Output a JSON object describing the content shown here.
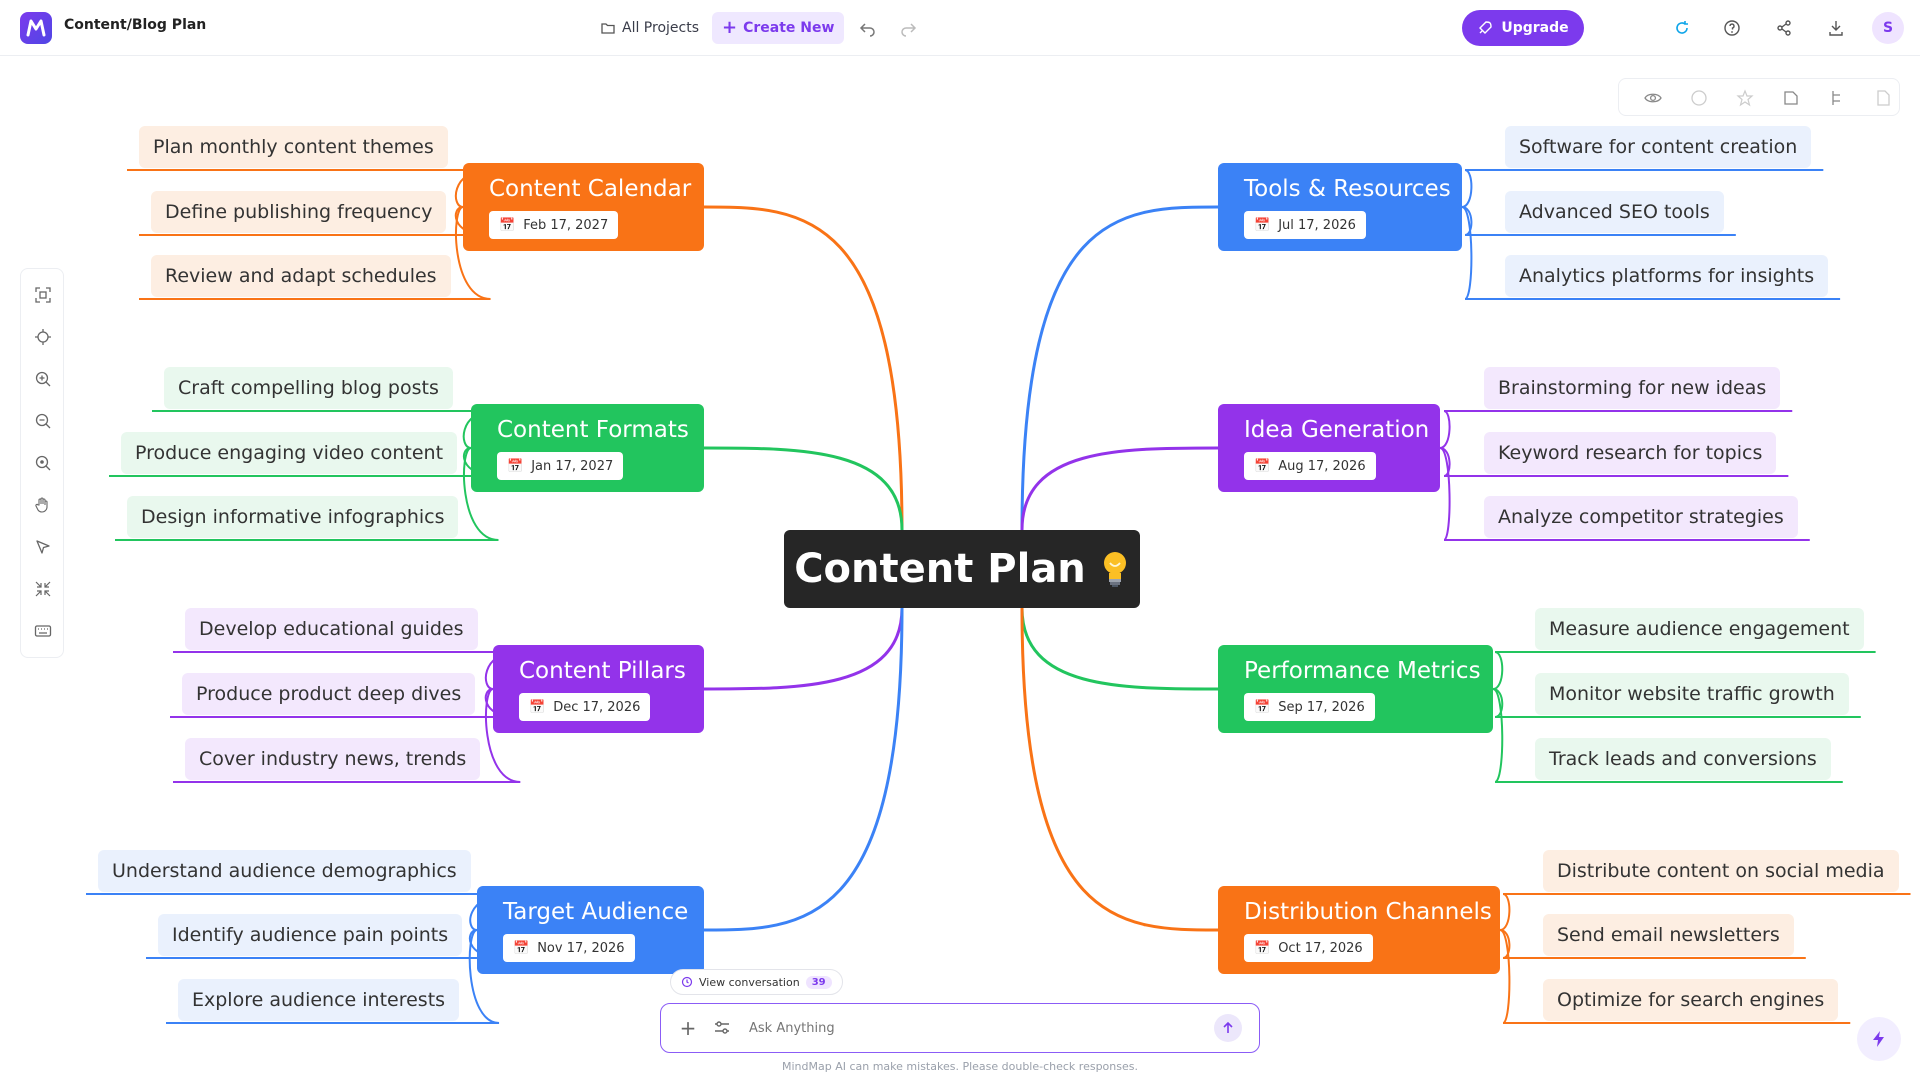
{
  "header": {
    "doc_title": "Content/Blog Plan",
    "all_projects": "All Projects",
    "create_new": "Create New",
    "upgrade": "Upgrade",
    "avatar_initial": "S"
  },
  "mindmap": {
    "center": "Content Plan",
    "branches": [
      {
        "title": "Content Calendar",
        "date": "Feb 17, 2027",
        "color": "#f97316",
        "leaves": [
          "Plan monthly content themes",
          "Define publishing frequency",
          "Review and adapt schedules"
        ]
      },
      {
        "title": "Content Formats",
        "date": "Jan 17, 2027",
        "color": "#22c55e",
        "leaves": [
          "Craft compelling blog posts",
          "Produce engaging video content",
          "Design informative infographics"
        ]
      },
      {
        "title": "Content Pillars",
        "date": "Dec 17, 2026",
        "color": "#9333ea",
        "leaves": [
          "Develop educational guides",
          "Produce product deep dives",
          "Cover industry news, trends"
        ]
      },
      {
        "title": "Target Audience",
        "date": "Nov 17, 2026",
        "color": "#3b82f6",
        "leaves": [
          "Understand audience demographics",
          "Identify audience pain points",
          "Explore audience interests"
        ]
      },
      {
        "title": "Tools & Resources",
        "date": "Jul 17, 2026",
        "color": "#3b82f6",
        "leaves": [
          "Software for content creation",
          "Advanced SEO tools",
          "Analytics platforms for insights"
        ]
      },
      {
        "title": "Idea Generation",
        "date": "Aug 17, 2026",
        "color": "#9333ea",
        "leaves": [
          "Brainstorming for new ideas",
          "Keyword research for topics",
          "Analyze competitor strategies"
        ]
      },
      {
        "title": "Performance Metrics",
        "date": "Sep 17, 2026",
        "color": "#22c55e",
        "leaves": [
          "Measure audience engagement",
          "Monitor website traffic growth",
          "Track leads and conversions"
        ]
      },
      {
        "title": "Distribution Channels",
        "date": "Oct 17, 2026",
        "color": "#f97316",
        "leaves": [
          "Distribute content on social media",
          "Send email newsletters",
          "Optimize for search engines"
        ]
      }
    ]
  },
  "chat": {
    "view_conversation": "View conversation",
    "count": "39",
    "placeholder": "Ask Anything",
    "disclaimer": "MindMap AI can make mistakes. Please double-check responses."
  }
}
